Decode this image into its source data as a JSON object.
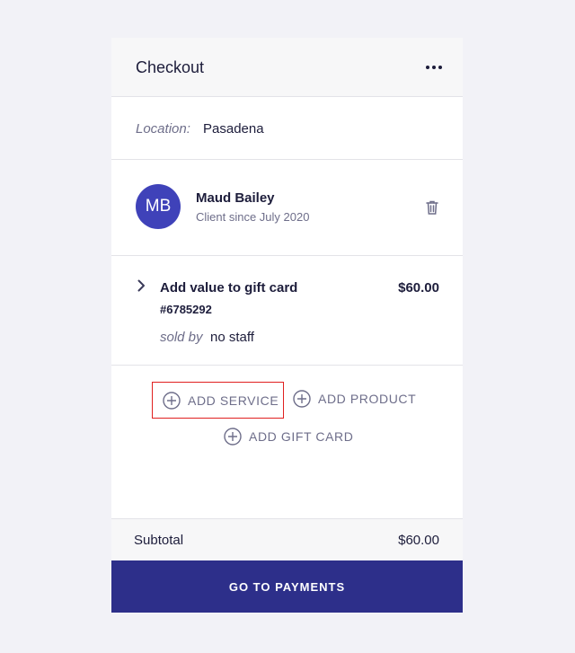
{
  "header": {
    "title": "Checkout",
    "more_icon": "more-horizontal-icon"
  },
  "location": {
    "label": "Location:",
    "value": "Pasadena"
  },
  "client": {
    "initials": "MB",
    "name": "Maud Bailey",
    "since": "Client since July 2020",
    "avatar_color": "#3f42b9",
    "remove_icon": "trash-icon"
  },
  "item": {
    "name": "Add value to gift card",
    "price": "$60.00",
    "code": "#6785292",
    "sold_by_label": "sold by",
    "staff": "no staff",
    "expand_icon": "chevron-right-icon"
  },
  "actions": {
    "add_service": "ADD SERVICE",
    "add_product": "ADD PRODUCT",
    "add_gift_card": "ADD GIFT CARD",
    "add_icon": "plus-circle-icon",
    "highlight_color": "#e0201f"
  },
  "summary": {
    "subtotal_label": "Subtotal",
    "subtotal_value": "$60.00"
  },
  "footer": {
    "pay_label": "GO TO PAYMENTS",
    "pay_color": "#2d2f8a"
  }
}
